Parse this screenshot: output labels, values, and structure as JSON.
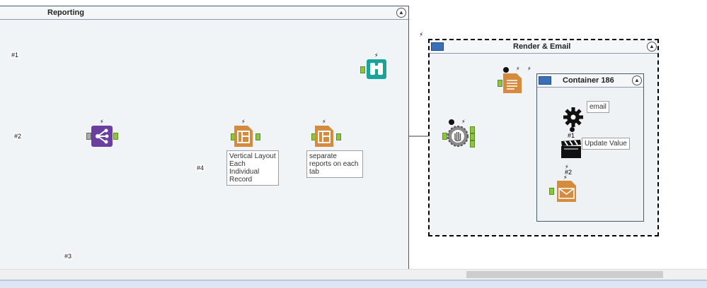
{
  "containers": {
    "reporting": {
      "title": "Reporting",
      "collapse_icon": "chevron-up-icon"
    },
    "render_email": {
      "title": "Render & Email",
      "collapse_icon": "chevron-up-icon"
    },
    "container_186": {
      "title": "Container 186",
      "collapse_icon": "chevron-up-icon"
    }
  },
  "connection_labels": {
    "c1": "#1",
    "c2": "#2",
    "c3": "#3",
    "c4": "#4"
  },
  "annotations": {
    "vertical_layout": "Vertical Layout Each Individual Record",
    "separate_reports": "separate reports on each tab",
    "email": "email",
    "update_value": "Update Value"
  },
  "tool_badges": {
    "control_param_1": "#1",
    "control_param_2": "#2"
  },
  "tools": [
    "union-tool",
    "layout-tool-1",
    "layout-tool-2",
    "browse-tool",
    "block-until-done-tool",
    "render-tool",
    "macro-input-tool",
    "action-tool",
    "email-tool"
  ],
  "colors": {
    "connection": "#3d3d3d",
    "anchor": "#8cc63f",
    "union_purple": "#6b3fa0",
    "layout_orange": "#d58a3c",
    "browse_teal": "#1aa39a",
    "container_bg": "#f1f4f6",
    "selected_border": "#000000"
  }
}
